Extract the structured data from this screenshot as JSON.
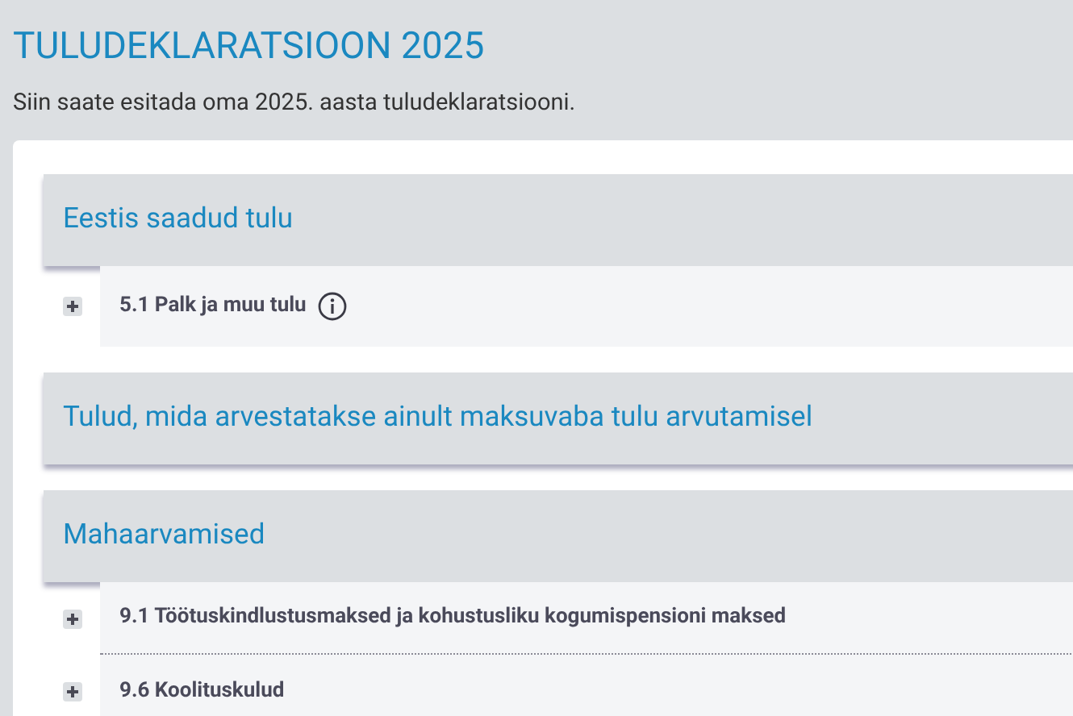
{
  "page": {
    "title": "TULUDEKLARATSIOON 2025",
    "subtitle": "Siin saate esitada oma 2025. aasta tuludeklaratsiooni."
  },
  "sections": [
    {
      "title": "Eestis saadud tulu",
      "items": [
        {
          "label": "5.1 Palk ja muu tulu",
          "expanded": false,
          "info": true
        }
      ]
    },
    {
      "title": "Tulud, mida arvestatakse ainult maksuvaba tulu arvutamisel"
    },
    {
      "title": "Mahaarvamised",
      "items": [
        {
          "label": "9.1 Töötuskindlustusmaksed ja kohustusliku kogumispensioni maksed",
          "expanded": false,
          "info": false
        },
        {
          "label": "9.6 Koolituskulud",
          "expanded": false,
          "info": false
        }
      ]
    }
  ]
}
